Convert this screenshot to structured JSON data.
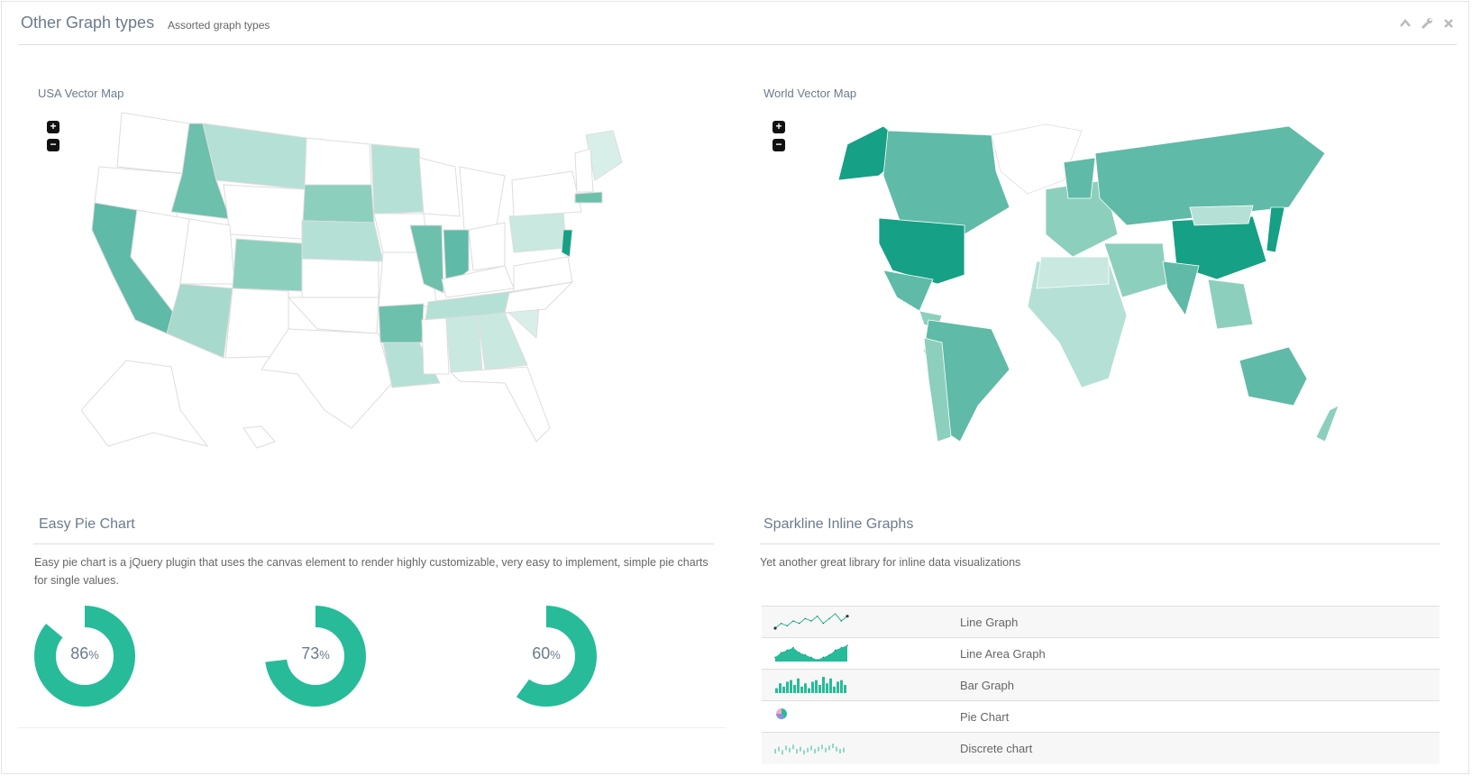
{
  "header": {
    "title": "Other Graph types",
    "subtitle": "Assorted graph types"
  },
  "icons": {
    "collapse": "chevron-up-icon",
    "settings": "wrench-icon",
    "close": "close-icon"
  },
  "usa_map": {
    "label": "USA Vector Map",
    "zoom_in": "+",
    "zoom_out": "−"
  },
  "world_map": {
    "label": "World Vector Map",
    "zoom_in": "+",
    "zoom_out": "−"
  },
  "pie_section": {
    "title": "Easy Pie Chart",
    "description": "Easy pie chart is a jQuery plugin that uses the canvas element to render highly customizable, very easy to implement, simple pie charts for single values.",
    "charts": [
      {
        "value": 86,
        "label": "86",
        "unit": "%"
      },
      {
        "value": 73,
        "label": "73",
        "unit": "%"
      },
      {
        "value": 60,
        "label": "60",
        "unit": "%"
      }
    ]
  },
  "sparkline_section": {
    "title": "Sparkline Inline Graphs",
    "description": "Yet another great library for inline data visualizations",
    "rows": [
      {
        "label": "Line Graph",
        "line": [
          3,
          5,
          4,
          6,
          5,
          7,
          6,
          8,
          5,
          7,
          9,
          6,
          8
        ]
      },
      {
        "label": "Line Area Graph",
        "area": [
          4,
          6,
          7,
          8,
          6,
          5,
          4,
          3,
          4,
          5,
          7,
          8,
          9
        ]
      },
      {
        "label": "Bar Graph",
        "bars": [
          3,
          6,
          4,
          7,
          8,
          5,
          9,
          4,
          6,
          3,
          7,
          8,
          5,
          10,
          6,
          9,
          4,
          7,
          8,
          5
        ]
      },
      {
        "label": "Pie Chart",
        "pie": [
          40,
          35,
          25
        ]
      },
      {
        "label": "Discrete chart",
        "discrete": [
          5,
          7,
          4,
          8,
          6,
          9,
          5,
          7,
          4,
          6,
          8,
          5,
          7,
          9,
          6,
          8,
          10,
          7,
          5,
          6
        ]
      }
    ]
  },
  "colors": {
    "accent": "#27bb99",
    "map_dark": "#16a085",
    "map_mid": "#5fbaa7",
    "map_light": "#b5e0d6"
  }
}
